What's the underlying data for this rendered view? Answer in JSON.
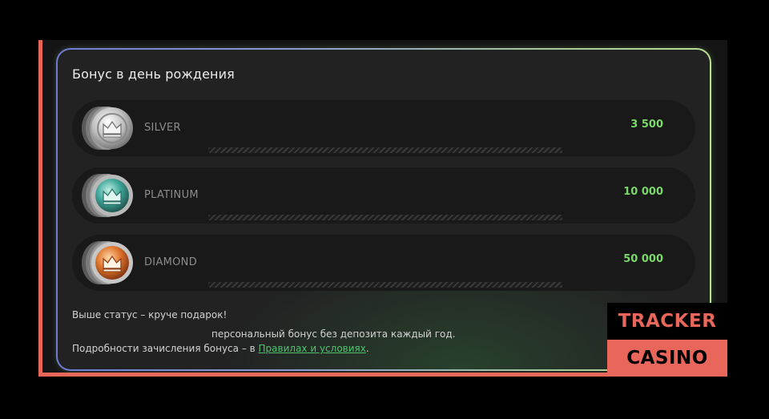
{
  "panel": {
    "title": "Бонус в день рождения",
    "tiers": [
      {
        "name": "SILVER",
        "amount": "3 500",
        "icon": "silver-crown-coin-icon",
        "color": "#d9d9d9"
      },
      {
        "name": "PLATINUM",
        "amount": "10 000",
        "icon": "platinum-crown-coin-icon",
        "color": "#3fa79a"
      },
      {
        "name": "DIAMOND",
        "amount": "50 000",
        "icon": "diamond-crown-coin-icon",
        "color": "#e0752d"
      }
    ],
    "footer": {
      "line1": "Выше статус – круче подарок!",
      "line2": "персональный бонус без депозита каждый год.",
      "line3_prefix": "Подробности зачисления бонуса – в ",
      "line3_link": "Правилах и условиях",
      "line3_suffix": "."
    }
  },
  "watermark": {
    "line1": "TRACKER",
    "line2": "CASINO"
  },
  "colors": {
    "accent_green": "#7bd86a",
    "brand_orange": "#e8665a",
    "link_green": "#4fc36e"
  }
}
